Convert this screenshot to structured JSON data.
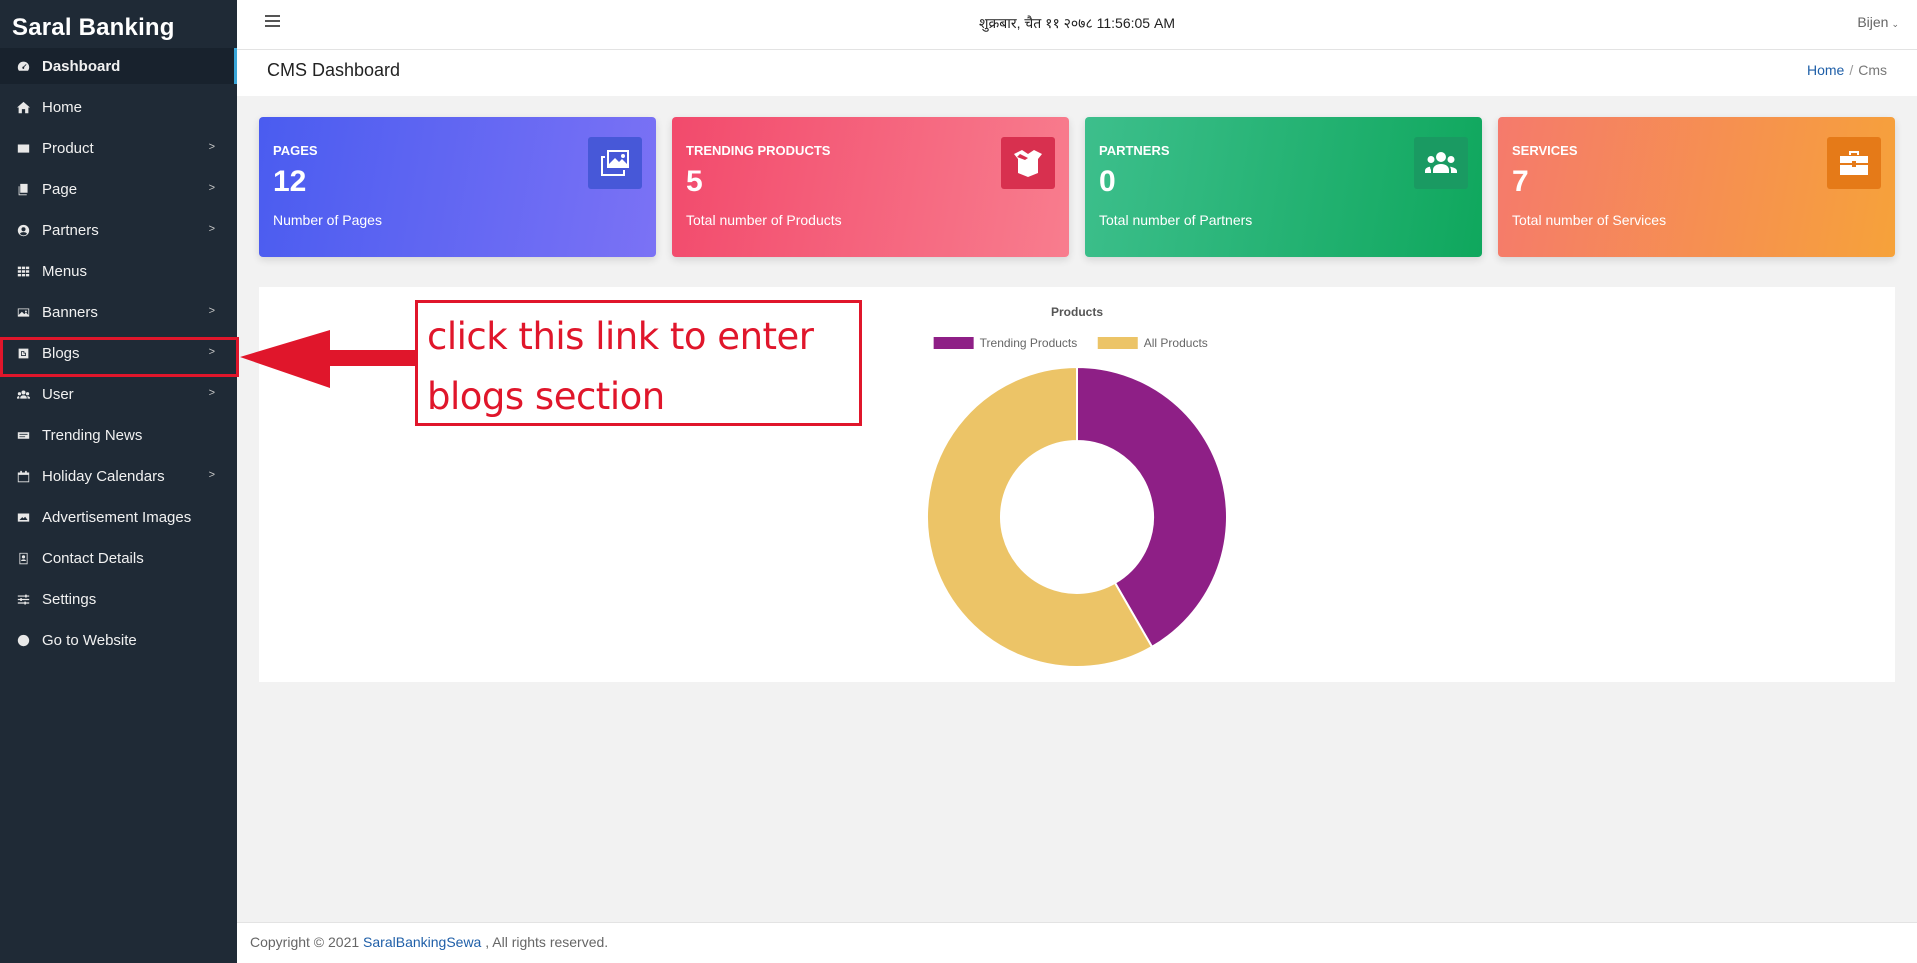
{
  "brand": "Saral Banking",
  "sidebar": {
    "items": [
      {
        "label": "Dashboard",
        "icon": "dashboard-icon",
        "chevron": false,
        "active": true
      },
      {
        "label": "Home",
        "icon": "home-icon",
        "chevron": false
      },
      {
        "label": "Product",
        "icon": "product-icon",
        "chevron": true
      },
      {
        "label": "Page",
        "icon": "page-icon",
        "chevron": true
      },
      {
        "label": "Partners",
        "icon": "user-circle-icon",
        "chevron": true
      },
      {
        "label": "Menus",
        "icon": "grid-icon",
        "chevron": false
      },
      {
        "label": "Banners",
        "icon": "image-icon",
        "chevron": true
      },
      {
        "label": "Blogs",
        "icon": "blog-icon",
        "chevron": true
      },
      {
        "label": "User",
        "icon": "users-icon",
        "chevron": true
      },
      {
        "label": "Trending News",
        "icon": "news-icon",
        "chevron": false
      },
      {
        "label": "Holiday Calendars",
        "icon": "calendar-icon",
        "chevron": true
      },
      {
        "label": "Advertisement Images",
        "icon": "ad-icon",
        "chevron": false
      },
      {
        "label": "Contact Details",
        "icon": "contact-icon",
        "chevron": false
      },
      {
        "label": "Settings",
        "icon": "sliders-icon",
        "chevron": false
      },
      {
        "label": "Go to Website",
        "icon": "globe-icon",
        "chevron": false
      }
    ],
    "chevron_glyph": ">"
  },
  "header": {
    "menu_icon": "hamburger-icon",
    "datetime": "शुक्रबार, चैत ११ २०७८ 11:56:05 AM",
    "user": "Bijen",
    "user_caret": "⌄"
  },
  "subheader": {
    "title": "CMS Dashboard",
    "breadcrumb_home": "Home",
    "breadcrumb_sep": "/",
    "breadcrumb_current": "Cms"
  },
  "cards": [
    {
      "title": "PAGES",
      "value": "12",
      "desc": "Number of Pages",
      "icon": "images-icon"
    },
    {
      "title": "TRENDING PRODUCTS",
      "value": "5",
      "desc": "Total number of Products",
      "icon": "box-open-icon"
    },
    {
      "title": "PARTNERS",
      "value": "0",
      "desc": "Total number of Partners",
      "icon": "users-icon"
    },
    {
      "title": "SERVICES",
      "value": "7",
      "desc": "Total number of Services",
      "icon": "briefcase-icon"
    }
  ],
  "annotation": {
    "line1": "click this link to enter",
    "line2": "blogs section"
  },
  "chart_data": {
    "type": "pie",
    "title": "Products",
    "labels": [
      "Trending Products",
      "All Products"
    ],
    "values": [
      5,
      7
    ],
    "colors": [
      "#8e1f86",
      "#ecc467"
    ],
    "legend": "top"
  },
  "footer": {
    "copyright": "Copyright © 2021",
    "company": "SaralBankingSewa",
    "rights": ", All rights reserved."
  },
  "colors": {
    "sidebar_bg": "#1f2a36",
    "annotation_red": "#e0162b",
    "link_blue": "#1f5fa8"
  }
}
